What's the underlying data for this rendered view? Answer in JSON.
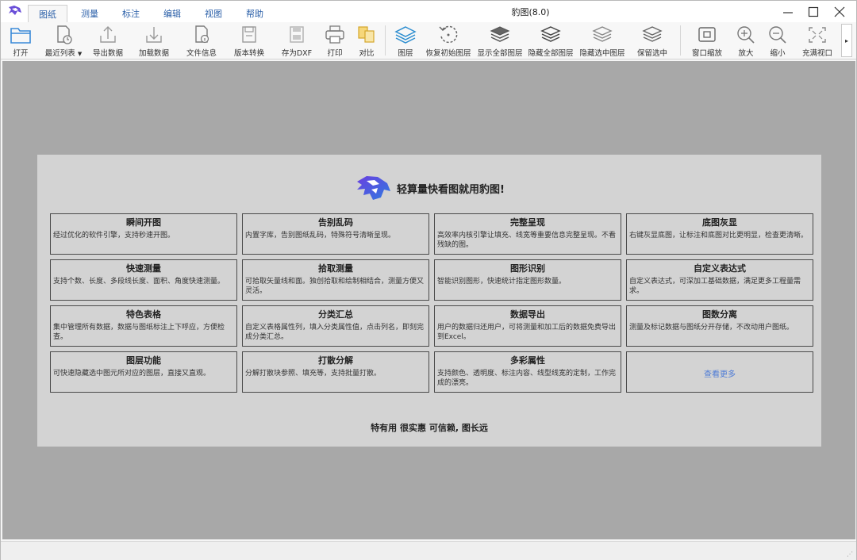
{
  "window": {
    "title": "豹图(8.0)"
  },
  "menu_tabs": [
    {
      "label": "图纸",
      "active": true
    },
    {
      "label": "测量"
    },
    {
      "label": "标注"
    },
    {
      "label": "编辑"
    },
    {
      "label": "视图"
    },
    {
      "label": "帮助"
    }
  ],
  "toolbar": {
    "open": "打开",
    "recent": "最近列表",
    "export_data": "导出数据",
    "load_data": "加载数据",
    "file_info": "文件信息",
    "version_convert": "版本转换",
    "save_dxf": "存为DXF",
    "print": "打印",
    "compare": "对比",
    "layers": "图层",
    "restore_layers": "恢复初始图层",
    "show_all_layers": "显示全部图层",
    "hide_all_layers": "隐藏全部图层",
    "hide_selected_layers": "隐藏选中图层",
    "keep_selected": "保留选中",
    "window_zoom": "窗口缩放",
    "zoom_in": "放大",
    "zoom_out": "缩小",
    "fit_view": "充满视口"
  },
  "welcome": {
    "slogan": "轻算量快看图就用豹图!",
    "cards": [
      {
        "title": "瞬间开图",
        "desc": "经过优化的软件引擎，支持秒速开图。"
      },
      {
        "title": "告别乱码",
        "desc": "内置字库，告别图纸乱码，特殊符号清晰呈现。"
      },
      {
        "title": "完整呈现",
        "desc": "高效率内核引擎让填充、线宽等重要信息完整呈现。不看残缺的图。"
      },
      {
        "title": "底图灰显",
        "desc": "右键灰显底图，让标注和底图对比更明显，检查更清晰。"
      },
      {
        "title": "快速测量",
        "desc": "支持个数、长度、多段线长度、面积、角度快速测量。"
      },
      {
        "title": "拾取测量",
        "desc": "可拾取矢量线和面。独创拾取和绘制相结合，测量方便又灵活。"
      },
      {
        "title": "图形识别",
        "desc": "智能识别图形，快速统计指定图形数量。"
      },
      {
        "title": "自定义表达式",
        "desc": "自定义表达式，可深加工基础数据，满足更多工程量需求。"
      },
      {
        "title": "特色表格",
        "desc": "集中管理所有数据，数据与图纸标注上下呼应，方便检查。"
      },
      {
        "title": "分类汇总",
        "desc": "自定义表格属性列，填入分类属性值，点击列名，即刻完成分类汇总。"
      },
      {
        "title": "数据导出",
        "desc": "用户的数据归还用户，可将测量和加工后的数据免费导出到Excel。"
      },
      {
        "title": "图数分离",
        "desc": "测量及标记数据与图纸分开存储，不改动用户图纸。"
      },
      {
        "title": "图层功能",
        "desc": "可快速隐藏选中图元所对应的图层，直接又直观。"
      },
      {
        "title": "打散分解",
        "desc": "分解打散块参照、填充等，支持批量打散。"
      },
      {
        "title": "多彩属性",
        "desc": "支持颜色、透明度、标注内容、线型线宽的定制，工作完成的漂亮。"
      }
    ],
    "more_link": "查看更多",
    "footer": "特有用 很实惠 可信赖, 图长远"
  },
  "colors": {
    "accent": "#2f6fb5",
    "canvas_bg": "#a8a8a8",
    "panel_bg": "#d3d3d3",
    "logo_purple": "#5b3fd6"
  }
}
